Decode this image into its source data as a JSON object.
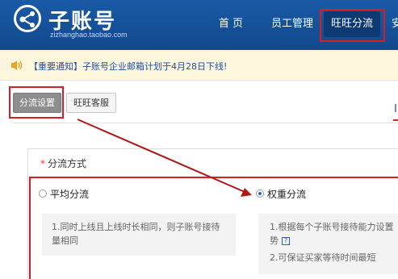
{
  "header": {
    "logo_title": "子账号",
    "logo_subtitle": "zizhanghao.taobao.com",
    "nav": {
      "home": "首 页",
      "staff": "员工管理",
      "wangwang": "旺旺分流",
      "more": "安"
    }
  },
  "notice": {
    "text": "【重要通知】子账号企业邮箱计划于4月28日下线!"
  },
  "tabs": {
    "active": "分流设置",
    "service": "旺旺客服"
  },
  "help_link": "I",
  "section": {
    "required_mark": "*",
    "title": "分流方式"
  },
  "options": {
    "average": {
      "label": "平均分流",
      "desc": "1.同时上线且上线时长相同，则子账号接待量相同",
      "selected": false
    },
    "weighted": {
      "label": "权重分流",
      "desc1": "1.根据每个子账号接待能力设置",
      "desc1b": "势",
      "help_icon": "?",
      "desc2": "2.可保证买家等待时间最短",
      "selected": true
    }
  },
  "colors": {
    "header_blue": "#13509a",
    "annotation_red": "#d81e1e",
    "link_blue": "#1f4fa8"
  },
  "icons": {
    "logo": "share-network-icon",
    "notice": "speaker-icon",
    "help": "question-icon"
  }
}
